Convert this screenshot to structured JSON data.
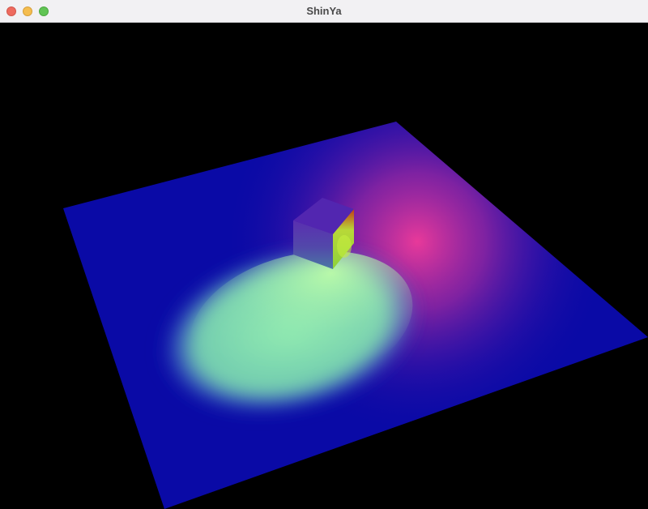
{
  "window": {
    "title": "ShinYa"
  },
  "scene": {
    "background_color": "#000000",
    "floor_color": "#0a0aa6",
    "spotlight_color": "#b4ffaa",
    "pointlight_color": "#e8399a",
    "cube_colors": [
      "#5a30b4",
      "#4a6ea0",
      "#9ae03a",
      "#c83010"
    ]
  }
}
